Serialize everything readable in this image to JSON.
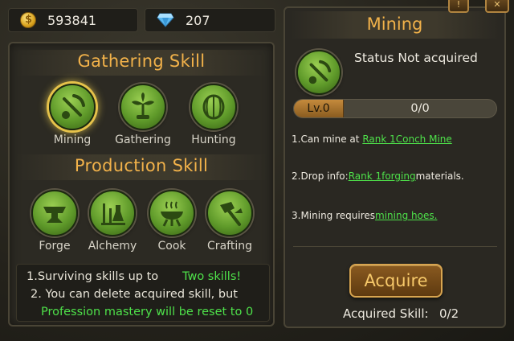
{
  "currency": {
    "gold": "593841",
    "gems": "207"
  },
  "left": {
    "gathering_title": "Gathering Skill",
    "production_title": "Production Skill",
    "gathering_skills": [
      {
        "label": "Mining",
        "icon": "pickaxe-icon",
        "selected": true
      },
      {
        "label": "Gathering",
        "icon": "plant-icon",
        "selected": false
      },
      {
        "label": "Hunting",
        "icon": "shell-icon",
        "selected": false
      }
    ],
    "production_skills": [
      {
        "label": "Forge",
        "icon": "anvil-icon"
      },
      {
        "label": "Alchemy",
        "icon": "flask-icon"
      },
      {
        "label": "Cook",
        "icon": "pot-icon"
      },
      {
        "label": "Crafting",
        "icon": "hammer-icon"
      }
    ],
    "notes": {
      "line1_a": "1.Surviving skills up to",
      "line1_b": "Two skills!",
      "line2": "2. You can delete acquired skill, but",
      "line3": "Profession mastery will be reset to 0"
    }
  },
  "right": {
    "title": "Mining",
    "status_label": "Status",
    "status_value": "Not acquired",
    "level": "Lv.0",
    "progress": "0/0",
    "desc1_a": "1.Can mine at ",
    "desc1_link": "Rank 1Conch Mine",
    "desc2_a": "2.Drop info:",
    "desc2_link": "Rank 1forging",
    "desc2_b": "materials.",
    "desc3_a": "3.Mining requires",
    "desc3_link": "mining hoes.",
    "acquire_label": "Acquire",
    "acquired_label": "Acquired Skill:",
    "acquired_value": "0/2"
  }
}
